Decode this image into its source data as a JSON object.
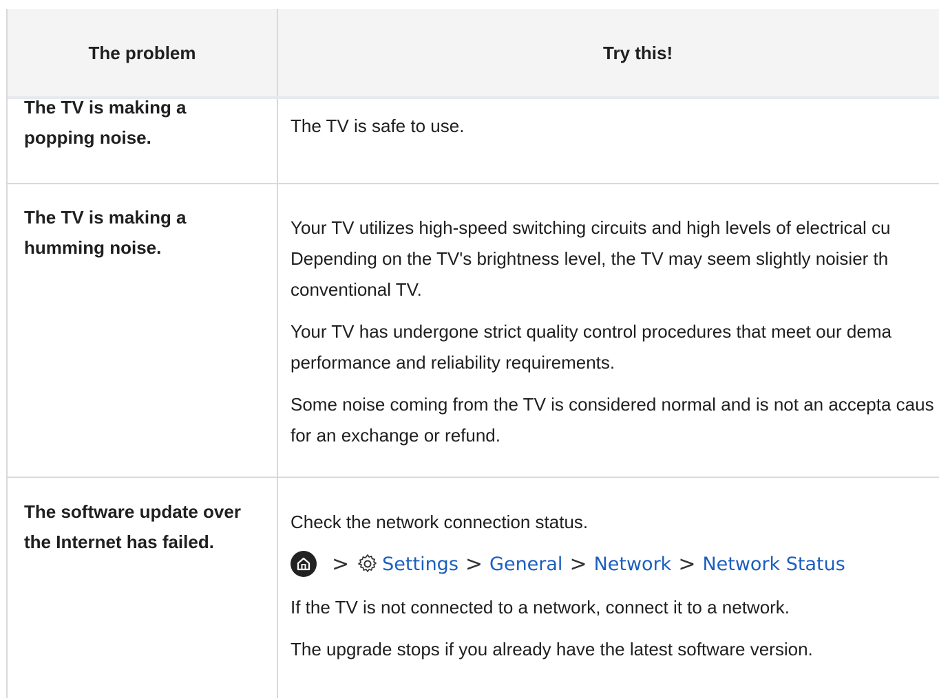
{
  "table": {
    "header": {
      "problem": "The problem",
      "try": "Try this!"
    },
    "rows": [
      {
        "problem": [
          "The TV is making a",
          "popping noise."
        ],
        "try": [
          "The TV is safe to use."
        ]
      },
      {
        "problem": [
          "The TV is making a",
          "humming noise."
        ],
        "try": [
          "Your TV utilizes high-speed switching circuits and high levels of electrical cu Depending on the TV's brightness level, the TV may seem slightly noisier th conventional TV.",
          "Your TV has undergone strict quality control procedures that meet our dema performance and reliability requirements.",
          "Some noise coming from the TV is considered normal and is not an accepta cause for an exchange or refund."
        ]
      },
      {
        "problem": [
          "The software update over",
          "the Internet has failed."
        ],
        "try_before": "Check the network connection status.",
        "path": {
          "items": [
            "Settings",
            "General",
            "Network",
            "Network Status"
          ],
          "separator": ">"
        },
        "try_after": [
          "If the TV is not connected to a network, connect it to a network.",
          "The upgrade stops if you already have the latest software version."
        ]
      }
    ]
  },
  "colors": {
    "link": "#1a5fbf",
    "header_bg": "#f4f4f4",
    "border": "#d9d9d9"
  },
  "icons": [
    "home-icon",
    "gear-icon",
    "chevron-right-icon"
  ]
}
